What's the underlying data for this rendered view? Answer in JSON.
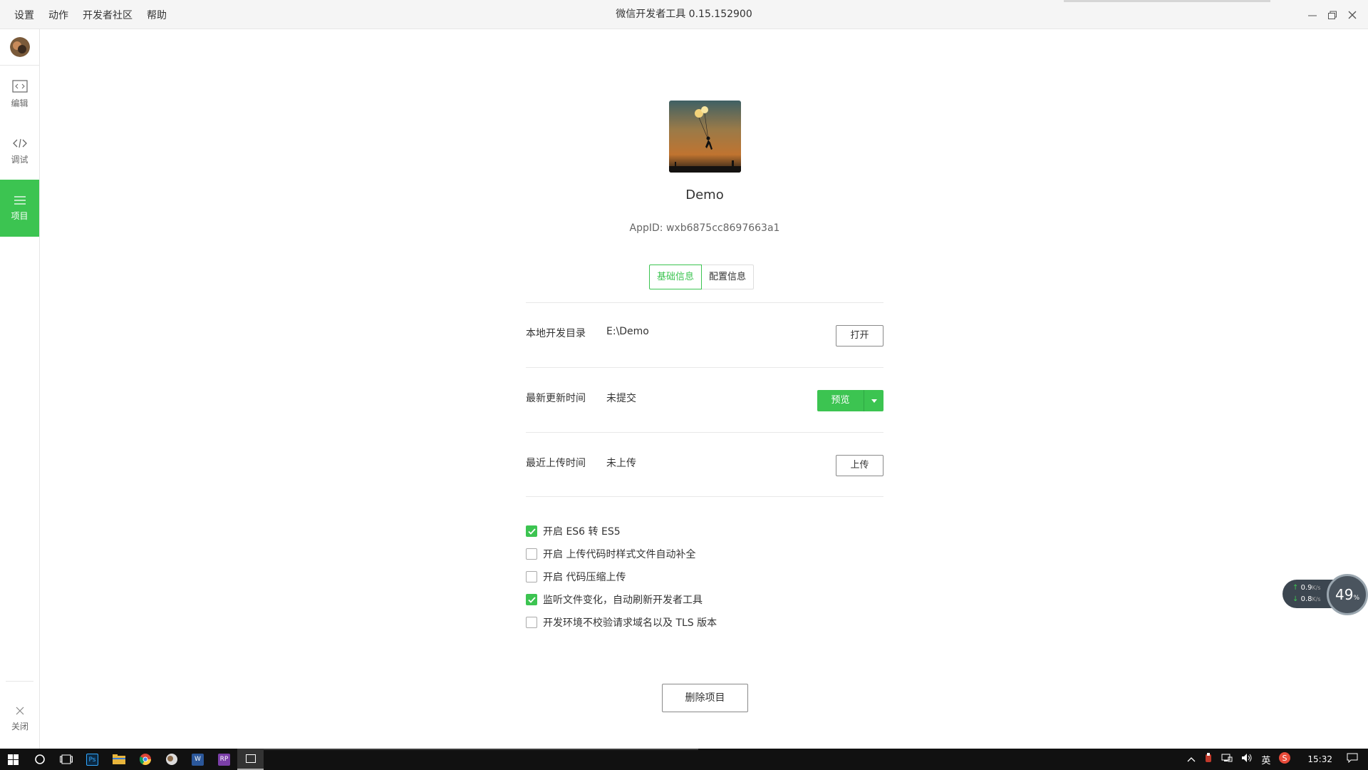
{
  "menu": [
    "设置",
    "动作",
    "开发者社区",
    "帮助"
  ],
  "app_title": "微信开发者工具 0.15.152900",
  "sidebar": {
    "items": [
      {
        "label": "编辑",
        "icon": "editor-icon"
      },
      {
        "label": "调试",
        "icon": "code-icon"
      },
      {
        "label": "项目",
        "icon": "menu-icon",
        "active": true
      }
    ],
    "close_label": "关闭"
  },
  "project": {
    "name": "Demo",
    "appid": "AppID: wxb6875cc8697663a1"
  },
  "tabs": [
    "基础信息",
    "配置信息"
  ],
  "rows": [
    {
      "label": "本地开发目录",
      "value": "E:\\Demo",
      "button": "打开"
    },
    {
      "label": "最新更新时间",
      "value": "未提交",
      "button": "预览"
    },
    {
      "label": "最近上传时间",
      "value": "未上传",
      "button": "上传"
    }
  ],
  "options": [
    {
      "label": "开启 ES6 转 ES5",
      "checked": true
    },
    {
      "label": "开启 上传代码时样式文件自动补全",
      "checked": false
    },
    {
      "label": "开启 代码压缩上传",
      "checked": false
    },
    {
      "label": "监听文件变化，自动刷新开发者工具",
      "checked": true
    },
    {
      "label": "开发环境不校验请求域名以及 TLS 版本",
      "checked": false
    }
  ],
  "delete_label": "删除项目",
  "speed": {
    "up": "0.9",
    "down": "0.8",
    "unit": "K/s",
    "percent": "49",
    "percent_sign": "%"
  },
  "taskbar": {
    "apps": [
      "Ps",
      "W",
      "RP"
    ],
    "ime": "英",
    "time": "15:32"
  },
  "colors": {
    "accent": "#3cc451",
    "taskbar": "#111111"
  }
}
